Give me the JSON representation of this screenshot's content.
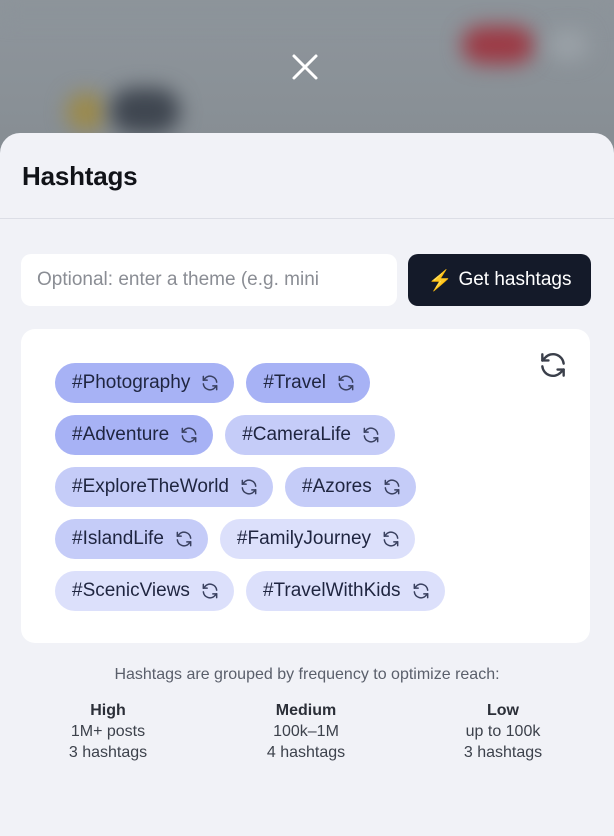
{
  "sheet": {
    "title": "Hashtags"
  },
  "input": {
    "placeholder": "Optional: enter a theme (e.g. mini",
    "value": ""
  },
  "get_button": {
    "label": "Get hashtags",
    "icon": "lightning-icon"
  },
  "tags": [
    {
      "text": "#Photography",
      "group": "high"
    },
    {
      "text": "#Travel",
      "group": "high"
    },
    {
      "text": "#Adventure",
      "group": "high"
    },
    {
      "text": "#CameraLife",
      "group": "medium"
    },
    {
      "text": "#ExploreTheWorld",
      "group": "medium"
    },
    {
      "text": "#Azores",
      "group": "medium"
    },
    {
      "text": "#IslandLife",
      "group": "medium"
    },
    {
      "text": "#FamilyJourney",
      "group": "low"
    },
    {
      "text": "#ScenicViews",
      "group": "low"
    },
    {
      "text": "#TravelWithKids",
      "group": "low"
    }
  ],
  "legend": {
    "intro": "Hashtags are grouped by frequency to optimize reach:",
    "groups": [
      {
        "name": "High",
        "range": "1M+ posts",
        "count": "3 hashtags"
      },
      {
        "name": "Medium",
        "range": "100k–1M",
        "count": "4 hashtags"
      },
      {
        "name": "Low",
        "range": "up to 100k",
        "count": "3 hashtags"
      }
    ]
  },
  "colors": {
    "high": "#a7b2f5",
    "medium": "#c5ccf8",
    "low": "#dce0fb",
    "button": "#141a29"
  }
}
